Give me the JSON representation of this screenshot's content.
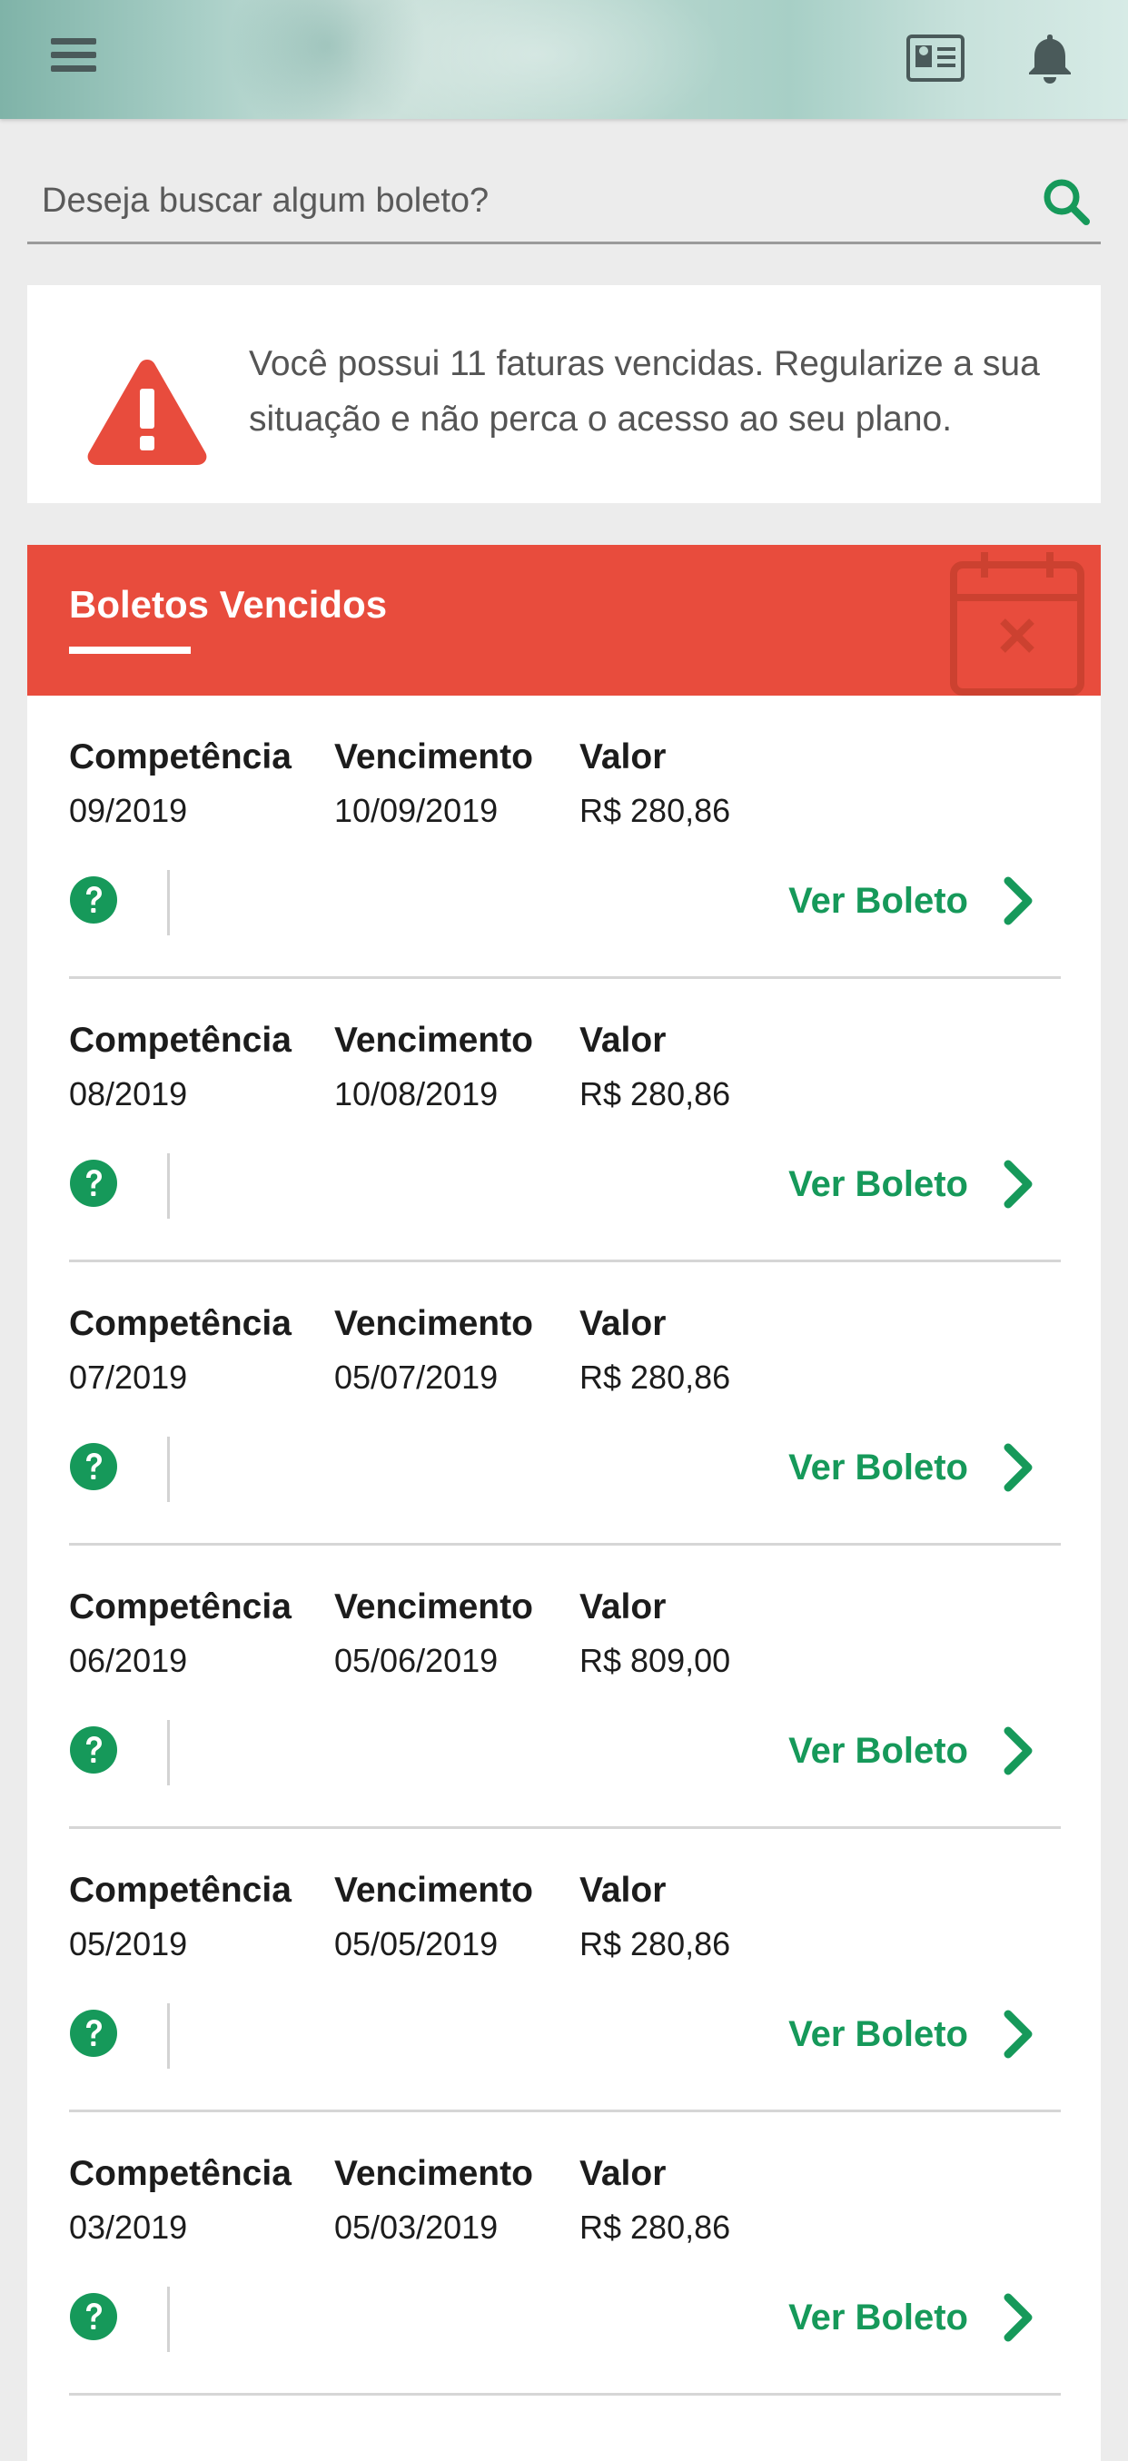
{
  "header": {
    "menu_icon": "hamburger-menu-icon",
    "card_icon": "id-card-icon",
    "bell_icon": "bell-icon"
  },
  "search": {
    "placeholder": "Deseja buscar algum boleto?",
    "icon": "search-icon"
  },
  "alert": {
    "icon": "warning-triangle-icon",
    "message": "Você possui 11 faturas vencidas. Regularize a sua situação e não perca o acesso ao seu plano."
  },
  "panel": {
    "title": "Boletos Vencidos",
    "icon": "calendar-x-icon",
    "column_labels": {
      "competencia": "Competência",
      "vencimento": "Vencimento",
      "valor": "Valor"
    },
    "action_label": "Ver Boleto",
    "rows": [
      {
        "competencia": "09/2019",
        "vencimento": "10/09/2019",
        "valor": "R$ 280,86"
      },
      {
        "competencia": "08/2019",
        "vencimento": "10/08/2019",
        "valor": "R$ 280,86"
      },
      {
        "competencia": "07/2019",
        "vencimento": "05/07/2019",
        "valor": "R$ 280,86"
      },
      {
        "competencia": "06/2019",
        "vencimento": "05/06/2019",
        "valor": "R$ 809,00"
      },
      {
        "competencia": "05/2019",
        "vencimento": "05/05/2019",
        "valor": "R$ 280,86"
      },
      {
        "competencia": "03/2019",
        "vencimento": "05/03/2019",
        "valor": "R$ 280,86"
      }
    ]
  },
  "colors": {
    "accent_green": "#16995a",
    "alert_red": "#e84c3d",
    "background": "#ececec"
  }
}
